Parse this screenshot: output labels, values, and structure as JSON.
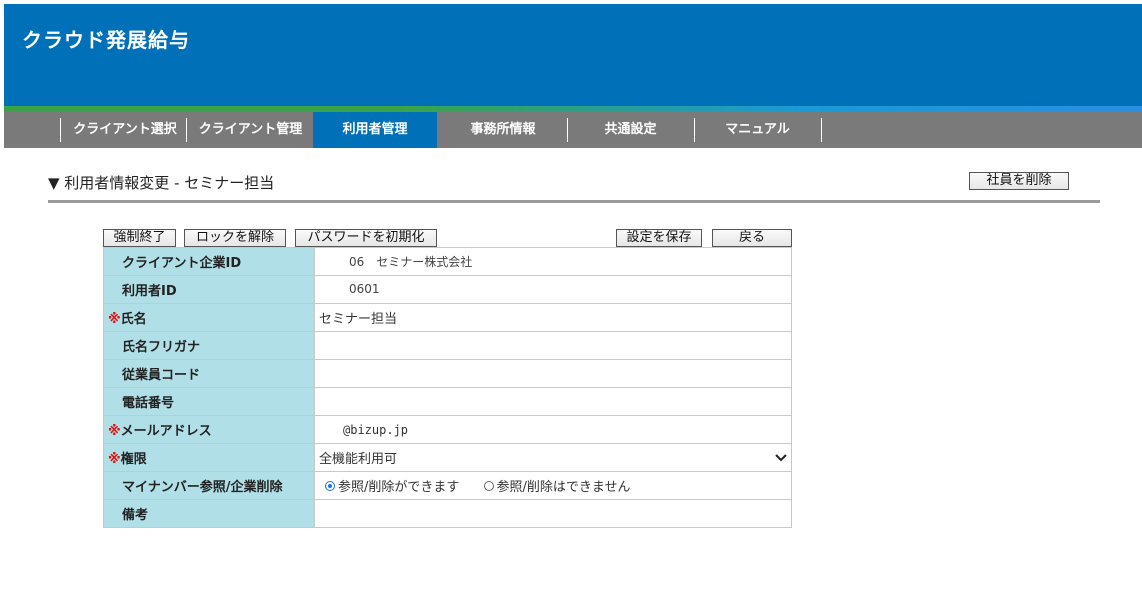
{
  "app": {
    "title": "クラウド発展給与"
  },
  "nav": {
    "tabs": [
      "クライアント選択",
      "クライアント管理",
      "利用者管理",
      "事務所情報",
      "共通設定",
      "マニュアル"
    ],
    "active": "利用者管理"
  },
  "page": {
    "title": "▼ 利用者情報変更 - セミナー担当",
    "delete_employee_button": "社員を削除"
  },
  "toolbar": {
    "force_quit": "強制終了",
    "unlock": "ロックを解除",
    "reset_password": "パスワードを初期化",
    "save": "設定を保存",
    "back": "戻る"
  },
  "form": {
    "client_id": {
      "label": "クライアント企業ID",
      "value": "06　セミナー株式会社"
    },
    "user_id": {
      "label": "利用者ID",
      "value": "0601"
    },
    "name": {
      "label": "氏名",
      "required_mark": "※",
      "value": "セミナー担当"
    },
    "name_kana": {
      "label": "氏名フリガナ",
      "value": ""
    },
    "employee_code": {
      "label": "従業員コード",
      "value": ""
    },
    "phone": {
      "label": "電話番号",
      "value": ""
    },
    "email": {
      "label": "メールアドレス",
      "required_mark": "※",
      "value": "　@bizup.jp"
    },
    "permission": {
      "label": "権限",
      "required_mark": "※",
      "value": "全機能利用可",
      "chevron": "chevron-down-icon"
    },
    "mynumber": {
      "label": "マイナンバー参照/企業削除",
      "option_yes": "参照/削除ができます",
      "option_no": "参照/削除はできません",
      "selected": "参照/削除ができます"
    },
    "remarks": {
      "label": "備考",
      "value": ""
    }
  },
  "colors": {
    "header": "#0070b8",
    "nav": "#7a7a7a",
    "label_bg": "#b1dfe7",
    "required": "#dd1111"
  }
}
